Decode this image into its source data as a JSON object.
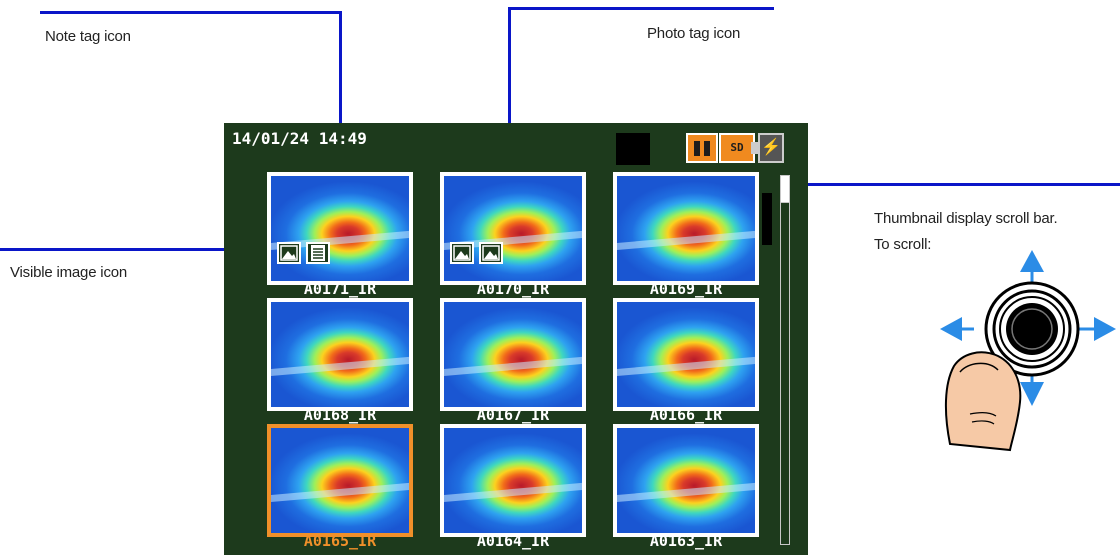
{
  "callouts": {
    "note_tag": "Note tag icon",
    "photo_tag": "Photo tag icon",
    "visible_image": "Visible image icon",
    "scroll_bar_line1": "Thumbnail display scroll bar.",
    "scroll_bar_line2": "To scroll:"
  },
  "screen": {
    "datetime": "14/01/24 14:49",
    "status": {
      "sd_label": "SD",
      "power_glyph": "⚡"
    },
    "thumbnails": [
      {
        "label": "A0171_IR",
        "selected": false,
        "tags": [
          "visible-image",
          "note"
        ]
      },
      {
        "label": "A0170_IR",
        "selected": false,
        "tags": [
          "visible-image",
          "photo"
        ]
      },
      {
        "label": "A0169_IR",
        "selected": false,
        "tags": []
      },
      {
        "label": "A0168_IR",
        "selected": false,
        "tags": []
      },
      {
        "label": "A0167_IR",
        "selected": false,
        "tags": []
      },
      {
        "label": "A0166_IR",
        "selected": false,
        "tags": []
      },
      {
        "label": "A0165_IR",
        "selected": true,
        "tags": []
      },
      {
        "label": "A0164_IR",
        "selected": false,
        "tags": []
      },
      {
        "label": "A0163_IR",
        "selected": false,
        "tags": []
      }
    ]
  },
  "colors": {
    "screen_bg": "#1d3a1c",
    "accent": "#f0902a",
    "callout_line": "#0a16c8",
    "arrow": "#2b8ce6"
  }
}
